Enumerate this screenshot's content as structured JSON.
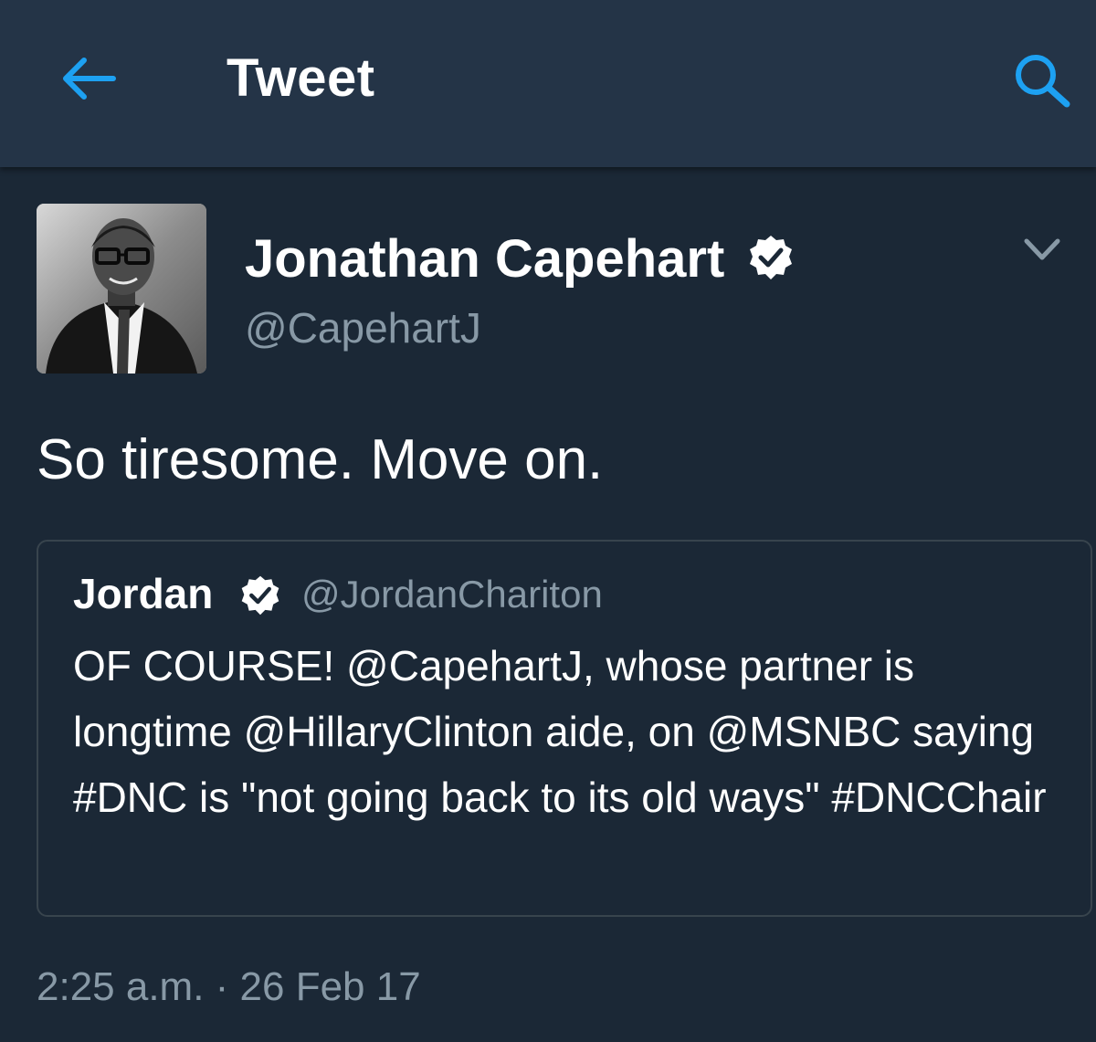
{
  "header": {
    "title": "Tweet",
    "back_icon": "arrow-left-icon",
    "search_icon": "search-icon"
  },
  "tweet": {
    "display_name": "Jonathan Capehart",
    "handle": "@CapehartJ",
    "verified": true,
    "text": "So tiresome. Move on.",
    "timestamp": "2:25 a.m. · 26 Feb 17"
  },
  "quoted_tweet": {
    "display_name": "Jordan",
    "handle": "@JordanChariton",
    "verified": true,
    "text": "OF COURSE! @CapehartJ, whose partner is longtime @HillaryClinton aide, on @MSNBC saying #DNC is \"not going back to its old ways\" #DNCChair"
  },
  "colors": {
    "background": "#1b2836",
    "header_bg": "#243447",
    "accent": "#1da1f2",
    "secondary_text": "#8899a6",
    "border": "#38444d"
  }
}
